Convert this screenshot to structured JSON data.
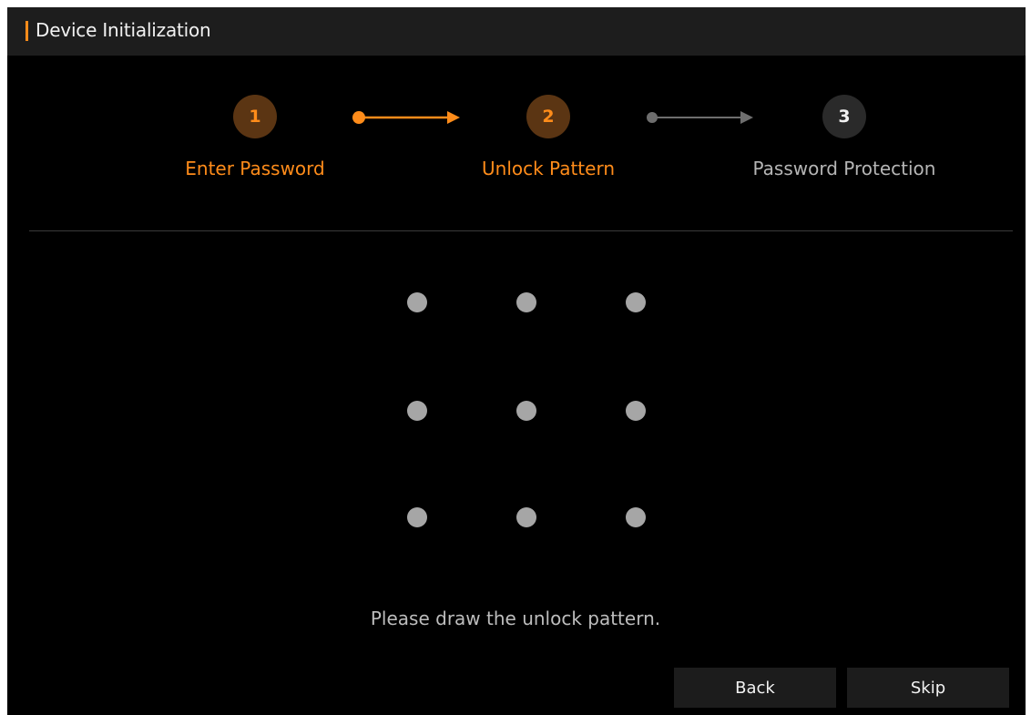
{
  "header": {
    "title": "Device Initialization"
  },
  "steps": [
    {
      "number": "1",
      "label": "Enter Password",
      "state": "done"
    },
    {
      "number": "2",
      "label": "Unlock Pattern",
      "state": "active"
    },
    {
      "number": "3",
      "label": "Password Protection",
      "state": "pending"
    }
  ],
  "pattern": {
    "rows": 3,
    "cols": 3,
    "instruction": "Please draw the unlock pattern."
  },
  "footer": {
    "back_label": "Back",
    "skip_label": "Skip"
  },
  "colors": {
    "accent": "#ff8c1a",
    "background": "#000000",
    "titlebar": "#1d1d1d",
    "pattern_dot": "#a6a6a6",
    "pending_connector": "#6e6e6e"
  }
}
